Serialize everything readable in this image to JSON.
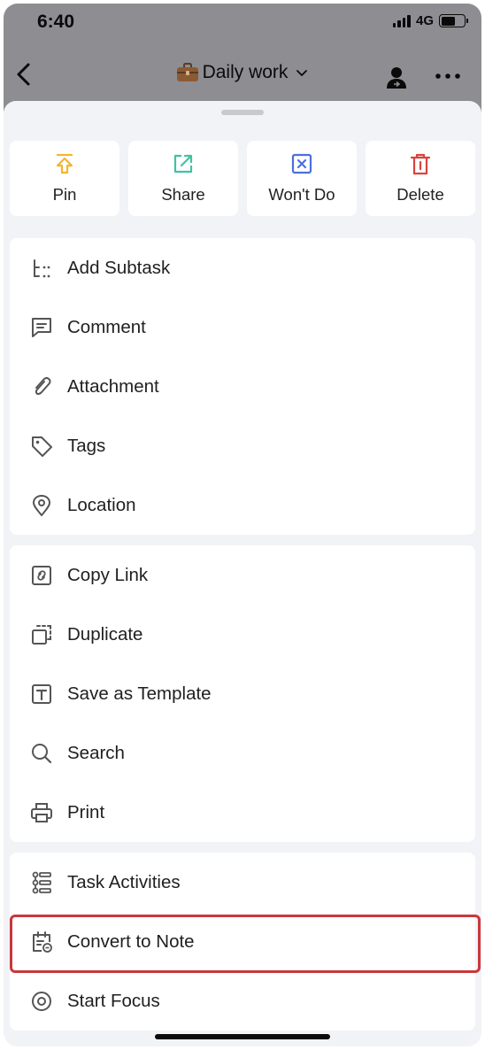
{
  "status_bar": {
    "time": "6:40",
    "network": "4G"
  },
  "nav": {
    "title": "Daily work",
    "title_icon": "briefcase-icon"
  },
  "quick_actions": [
    {
      "label": "Pin",
      "icon": "pin-icon",
      "color": "#f5b52c"
    },
    {
      "label": "Share",
      "icon": "share-icon",
      "color": "#3fc3a0"
    },
    {
      "label": "Won't Do",
      "icon": "wont-do-icon",
      "color": "#4c6fde"
    },
    {
      "label": "Delete",
      "icon": "delete-icon",
      "color": "#d9433d"
    }
  ],
  "groups": [
    {
      "items": [
        {
          "label": "Add Subtask",
          "icon": "subtask-icon"
        },
        {
          "label": "Comment",
          "icon": "comment-icon"
        },
        {
          "label": "Attachment",
          "icon": "attachment-icon"
        },
        {
          "label": "Tags",
          "icon": "tag-icon"
        },
        {
          "label": "Location",
          "icon": "location-icon"
        }
      ]
    },
    {
      "items": [
        {
          "label": "Copy Link",
          "icon": "link-icon"
        },
        {
          "label": "Duplicate",
          "icon": "duplicate-icon"
        },
        {
          "label": "Save as Template",
          "icon": "template-icon"
        },
        {
          "label": "Search",
          "icon": "search-icon"
        },
        {
          "label": "Print",
          "icon": "print-icon"
        }
      ]
    },
    {
      "items": [
        {
          "label": "Task Activities",
          "icon": "activities-icon"
        },
        {
          "label": "Convert to Note",
          "icon": "convert-note-icon",
          "highlighted": true
        },
        {
          "label": "Start Focus",
          "icon": "focus-icon"
        }
      ]
    }
  ],
  "colors": {
    "highlight_border": "#c9373b",
    "icon_gray": "#555555"
  }
}
